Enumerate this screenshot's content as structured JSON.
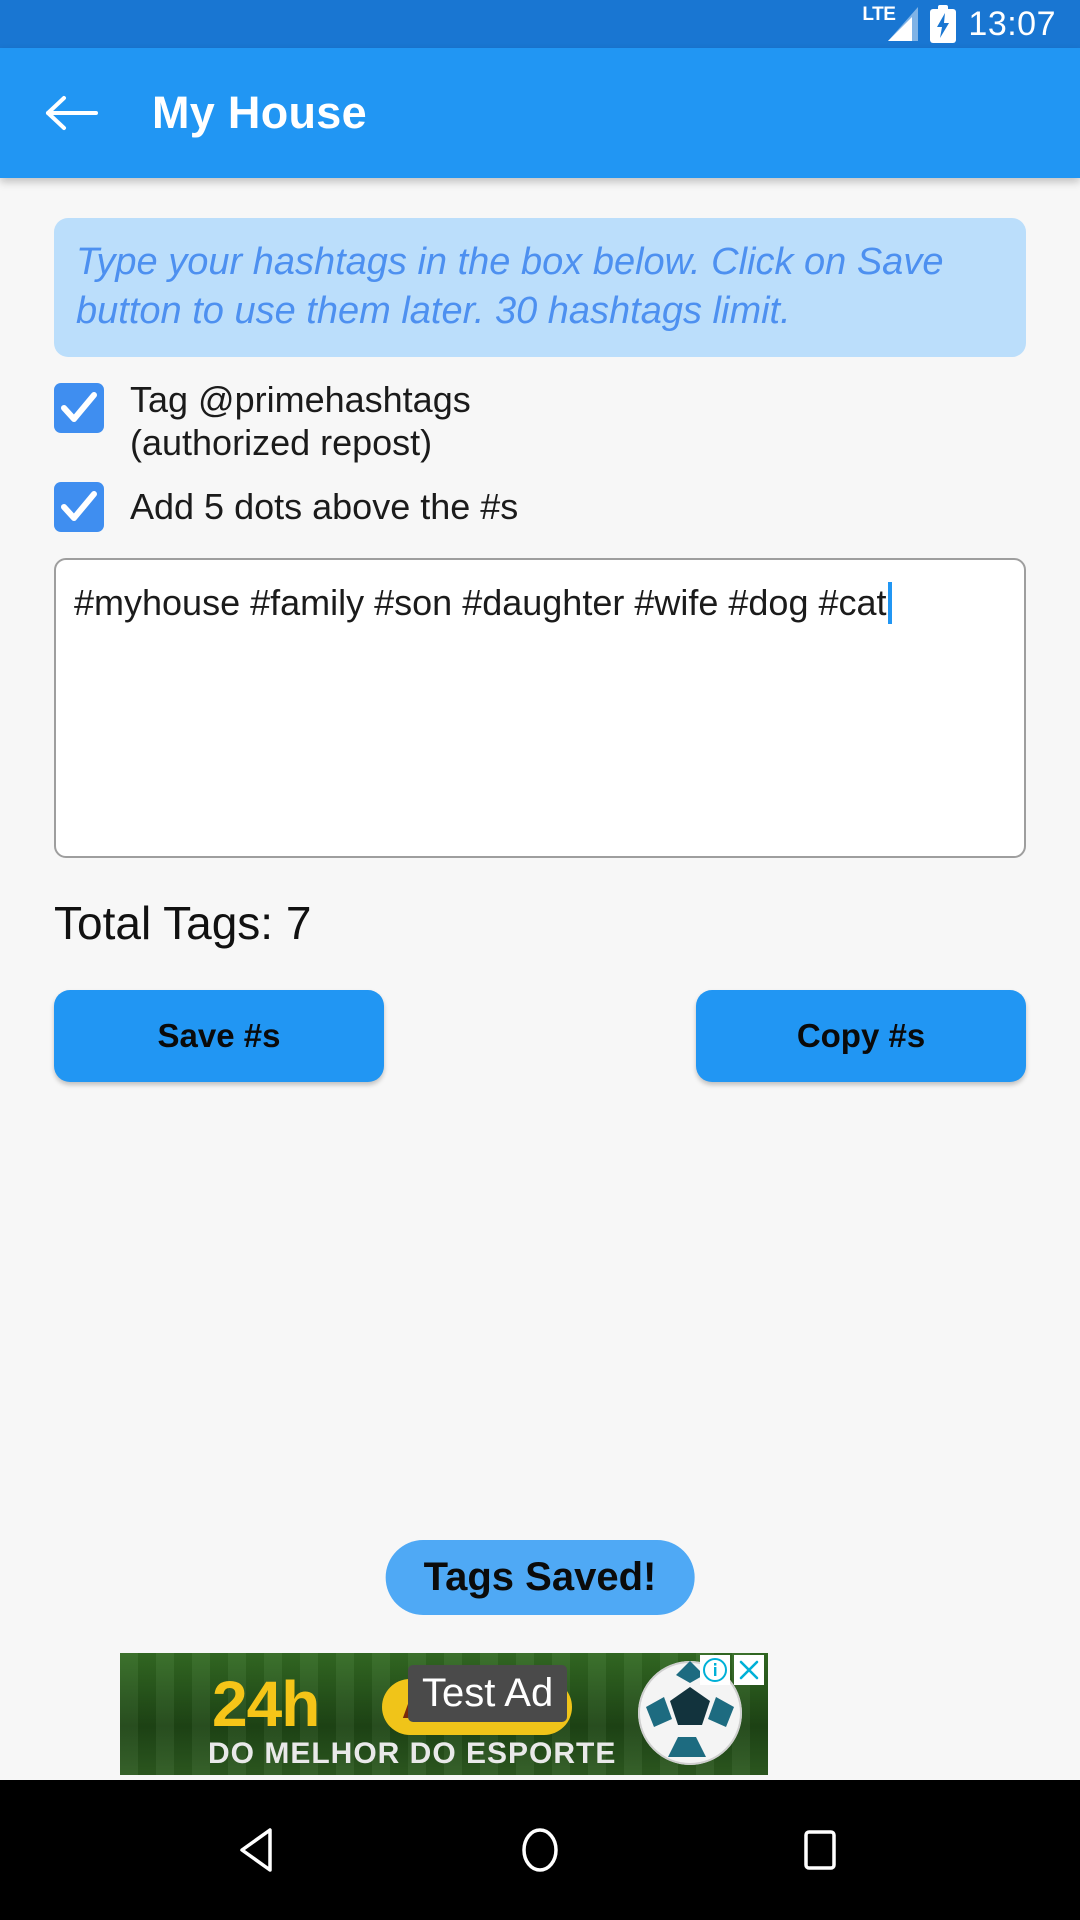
{
  "statusbar": {
    "network_label": "LTE",
    "signal_icon": "signal-triangle-icon",
    "battery_icon": "battery-charging-icon",
    "time": "13:07"
  },
  "appbar": {
    "back_icon": "back-arrow-icon",
    "title": "My House"
  },
  "banner": {
    "text": "Type your hashtags in the box below. Click on Save button to use them later. 30 hashtags limit.",
    "bg_color": "#bbdefb",
    "text_color": "#4d90f0"
  },
  "options": [
    {
      "label": "Tag @primehashtags\n(authorized repost)",
      "checked": true,
      "icon": "check-icon"
    },
    {
      "label": "Add 5 dots above the #s",
      "checked": true,
      "icon": "check-icon"
    }
  ],
  "option_labels": {
    "tag_line1": "Tag @primehashtags",
    "tag_line2": "(authorized repost)",
    "dots": "Add 5 dots above the #s"
  },
  "hashtag_input": {
    "value": "#myhouse #family #son #daughter #wife #dog #cat",
    "placeholder": "",
    "caret_visible": true
  },
  "total_tags": {
    "label": "Total Tags: 7",
    "count": 7
  },
  "buttons": {
    "save_label": "Save #s",
    "copy_label": "Copy #s",
    "accent_color": "#2196f3"
  },
  "toast": {
    "message": "Tags Saved!",
    "bg_color": "#4fa9f5"
  },
  "ad": {
    "overlay_label": "Test Ad",
    "headline": "24h",
    "pill_label": "AO VIVO",
    "subline": "DO MELHOR DO ESPORTE",
    "info_icon": "ad-info-icon",
    "close_icon": "ad-close-icon",
    "ball_icon": "soccer-ball-icon"
  },
  "navbar": {
    "back_icon": "nav-back-triangle-icon",
    "home_icon": "nav-home-circle-icon",
    "recents_icon": "nav-recents-square-icon"
  }
}
